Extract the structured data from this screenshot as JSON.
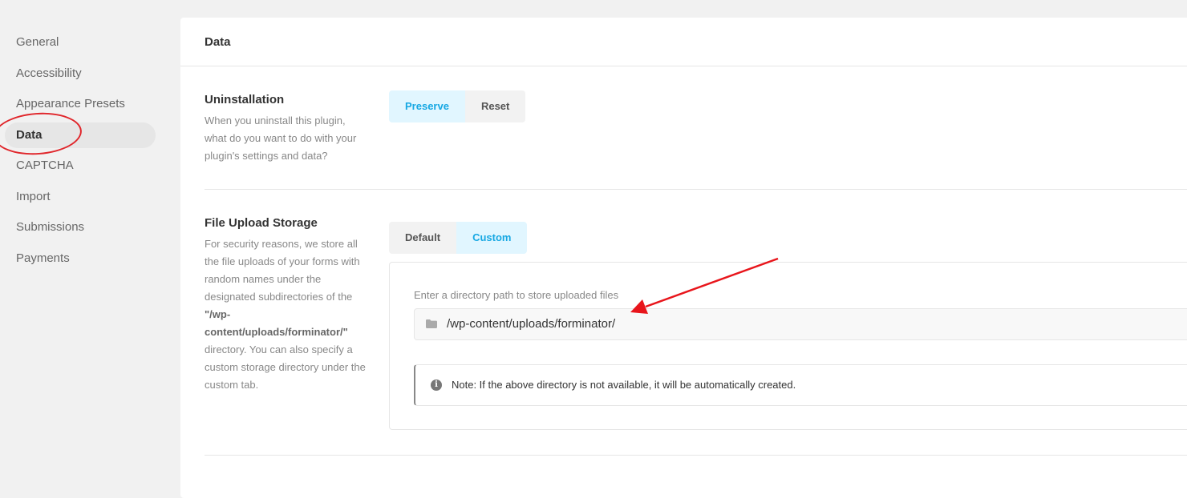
{
  "sidebar": {
    "items": [
      {
        "label": "General",
        "active": false
      },
      {
        "label": "Accessibility",
        "active": false
      },
      {
        "label": "Appearance Presets",
        "active": false
      },
      {
        "label": "Data",
        "active": true
      },
      {
        "label": "CAPTCHA",
        "active": false
      },
      {
        "label": "Import",
        "active": false
      },
      {
        "label": "Submissions",
        "active": false
      },
      {
        "label": "Payments",
        "active": false
      }
    ]
  },
  "panel": {
    "title": "Data"
  },
  "uninstallation": {
    "title": "Uninstallation",
    "description": "When you uninstall this plugin, what do you want to do with your plugin's settings and data?",
    "options": [
      {
        "label": "Preserve",
        "selected": true
      },
      {
        "label": "Reset",
        "selected": false
      }
    ]
  },
  "file_upload": {
    "title": "File Upload Storage",
    "desc_before": "For security reasons, we store all the file uploads of your forms with random names under the designated subdirectories of the ",
    "desc_path": "\"/wp-content/uploads/forminator/\"",
    "desc_after": " directory. You can also specify a custom storage directory under the custom tab.",
    "options": [
      {
        "label": "Default",
        "selected": false
      },
      {
        "label": "Custom",
        "selected": true
      }
    ],
    "field_label": "Enter a directory path to store uploaded files",
    "path_value": "/wp-content/uploads/forminator/",
    "folder_icon": "folder-icon",
    "notice_icon": "info-icon",
    "notice_text": "Note: If the above directory is not available, it will be automatically created."
  },
  "colors": {
    "accent": "#17a8e3",
    "accent_bg": "#e1f6ff",
    "annotation": "#e0262b"
  }
}
